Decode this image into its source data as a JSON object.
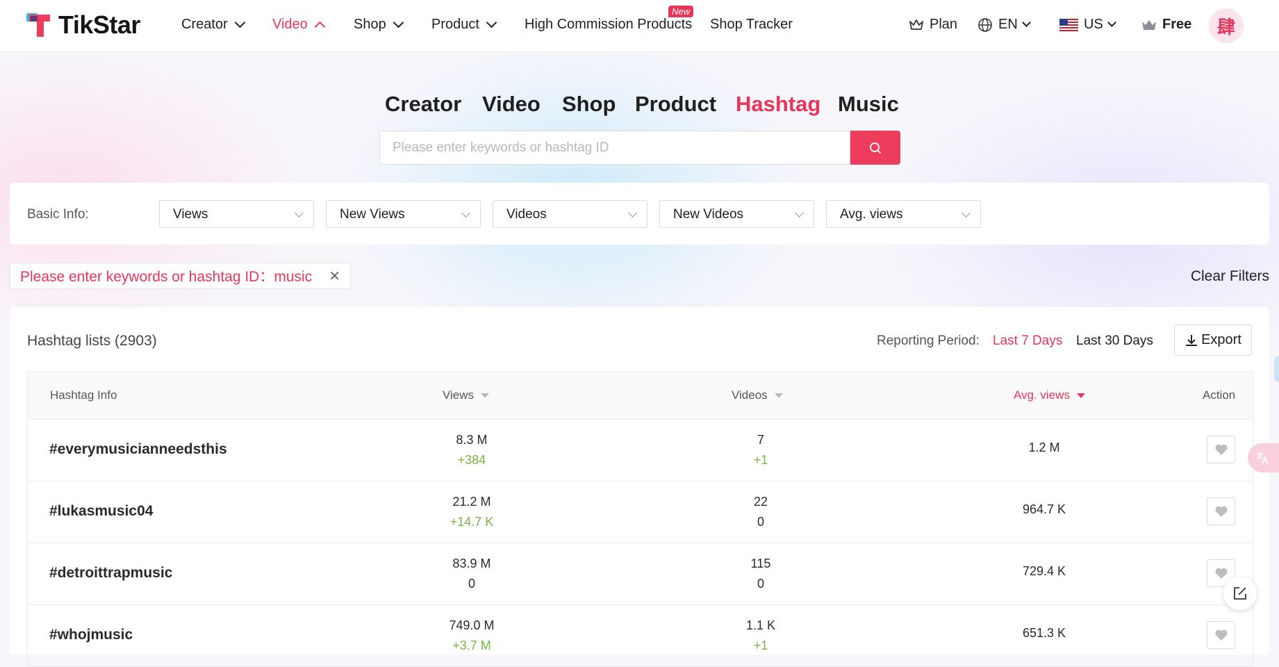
{
  "brand": {
    "name": "TikStar",
    "accent": "#e8355a"
  },
  "nav": {
    "items": [
      {
        "label": "Creator",
        "chevron": "down"
      },
      {
        "label": "Video",
        "chevron": "up",
        "active": true
      },
      {
        "label": "Shop",
        "chevron": "down"
      },
      {
        "label": "Product",
        "chevron": "down"
      },
      {
        "label": "High Commission Products",
        "badge": "New"
      },
      {
        "label": "Shop Tracker"
      }
    ],
    "plan": "Plan",
    "language": "EN",
    "region": "US",
    "tier": "Free",
    "avatar_char": "肆"
  },
  "category_tabs": [
    "Creator",
    "Video",
    "Shop",
    "Product",
    "Hashtag",
    "Music"
  ],
  "active_tab": "Hashtag",
  "search": {
    "placeholder": "Please enter keywords or hashtag ID"
  },
  "basic_info": {
    "label": "Basic Info:",
    "dropdowns": [
      "Views",
      "New Views",
      "Videos",
      "New Videos",
      "Avg. views"
    ]
  },
  "filter": {
    "chip_label": "Please enter keywords or hashtag ID：",
    "chip_value": "music",
    "clear_label": "Clear Filters"
  },
  "list": {
    "title": "Hashtag lists (2903)",
    "reporting_label": "Reporting Period:",
    "periods": [
      "Last 7 Days",
      "Last 30 Days"
    ],
    "active_period": "Last 7 Days",
    "export_label": "Export",
    "columns": {
      "info": "Hashtag Info",
      "views": "Views",
      "videos": "Videos",
      "avg": "Avg. views",
      "action": "Action"
    },
    "rows": [
      {
        "tag": "#everymusicianneedsthis",
        "views": "8.3 M",
        "views_delta": "+384",
        "videos": "7",
        "videos_delta": "+1",
        "avg": "1.2 M"
      },
      {
        "tag": "#lukasmusic04",
        "views": "21.2 M",
        "views_delta": "+14.7 K",
        "videos": "22",
        "videos_delta": "0",
        "avg": "964.7 K"
      },
      {
        "tag": "#detroittrapmusic",
        "views": "83.9 M",
        "views_delta": "0",
        "videos": "115",
        "videos_delta": "0",
        "avg": "729.4 K"
      },
      {
        "tag": "#whojmusic",
        "views": "749.0 M",
        "views_delta": "+3.7 M",
        "videos": "1.1 K",
        "videos_delta": "+1",
        "avg": "651.3 K"
      }
    ]
  }
}
